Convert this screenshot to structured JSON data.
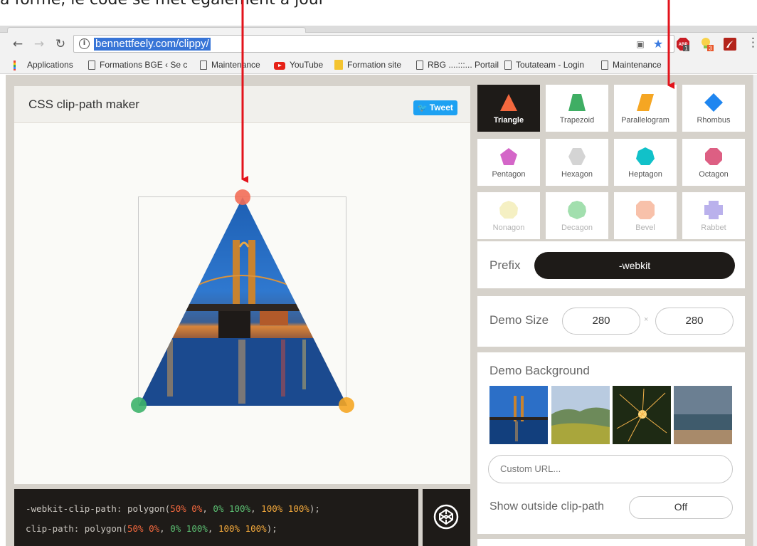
{
  "annotation": {
    "caption": "a forme, le code se met également à jour"
  },
  "browser": {
    "url": "bennettfeely.com/clippy/",
    "bookmarks": [
      {
        "label": "Applications",
        "icon": "apps-icon"
      },
      {
        "label": "Formations BGE ‹ Se c",
        "icon": "page-icon"
      },
      {
        "label": "Maintenance",
        "icon": "page-icon"
      },
      {
        "label": "YouTube",
        "icon": "youtube-icon"
      },
      {
        "label": "Formation site",
        "icon": "folder-icon"
      },
      {
        "label": "RBG ....:::... Portail",
        "icon": "page-icon"
      },
      {
        "label": "Toutateam - Login",
        "icon": "page-icon"
      },
      {
        "label": "Maintenance",
        "icon": "page-icon"
      }
    ],
    "ext_badges": {
      "abp": "1",
      "bulb": "3"
    }
  },
  "demo": {
    "title": "CSS clip-path maker",
    "tweet_label": "Tweet"
  },
  "code": {
    "line1": {
      "prop": "-webkit-clip-path: polygon(",
      "a": "50% 0%",
      "b": "0% 100%",
      "c": "100% 100%",
      "end": ");"
    },
    "line2": {
      "prop": "clip-path: polygon(",
      "a": "50% 0%",
      "b": "0% 100%",
      "c": "100% 100%",
      "end": ");"
    },
    "sep": ", "
  },
  "shapes": [
    {
      "label": "Triangle",
      "color": "#f3683e",
      "active": true
    },
    {
      "label": "Trapezoid",
      "color": "#3fae64"
    },
    {
      "label": "Parallelogram",
      "color": "#f5a623"
    },
    {
      "label": "Rhombus",
      "color": "#1f86f0"
    },
    {
      "label": "Pentagon",
      "color": "#d466c8"
    },
    {
      "label": "Hexagon",
      "color": "#d4d4d4"
    },
    {
      "label": "Heptagon",
      "color": "#11c1c9"
    },
    {
      "label": "Octagon",
      "color": "#dd5f83"
    },
    {
      "label": "Nonagon",
      "color": "#e9e07b",
      "faded": true
    },
    {
      "label": "Decagon",
      "color": "#32b94d",
      "faded": true
    },
    {
      "label": "Bevel",
      "color": "#f07845",
      "faded": true
    },
    {
      "label": "Rabbet",
      "color": "#6755d6",
      "faded": true
    }
  ],
  "prefix": {
    "label": "Prefix",
    "value": "-webkit"
  },
  "demo_size": {
    "label": "Demo Size",
    "width": "280",
    "height": "280",
    "sep": "×"
  },
  "demo_background": {
    "label": "Demo Background",
    "custom_url_placeholder": "Custom URL...",
    "outside_label": "Show outside clip-path",
    "outside_value": "Off"
  }
}
